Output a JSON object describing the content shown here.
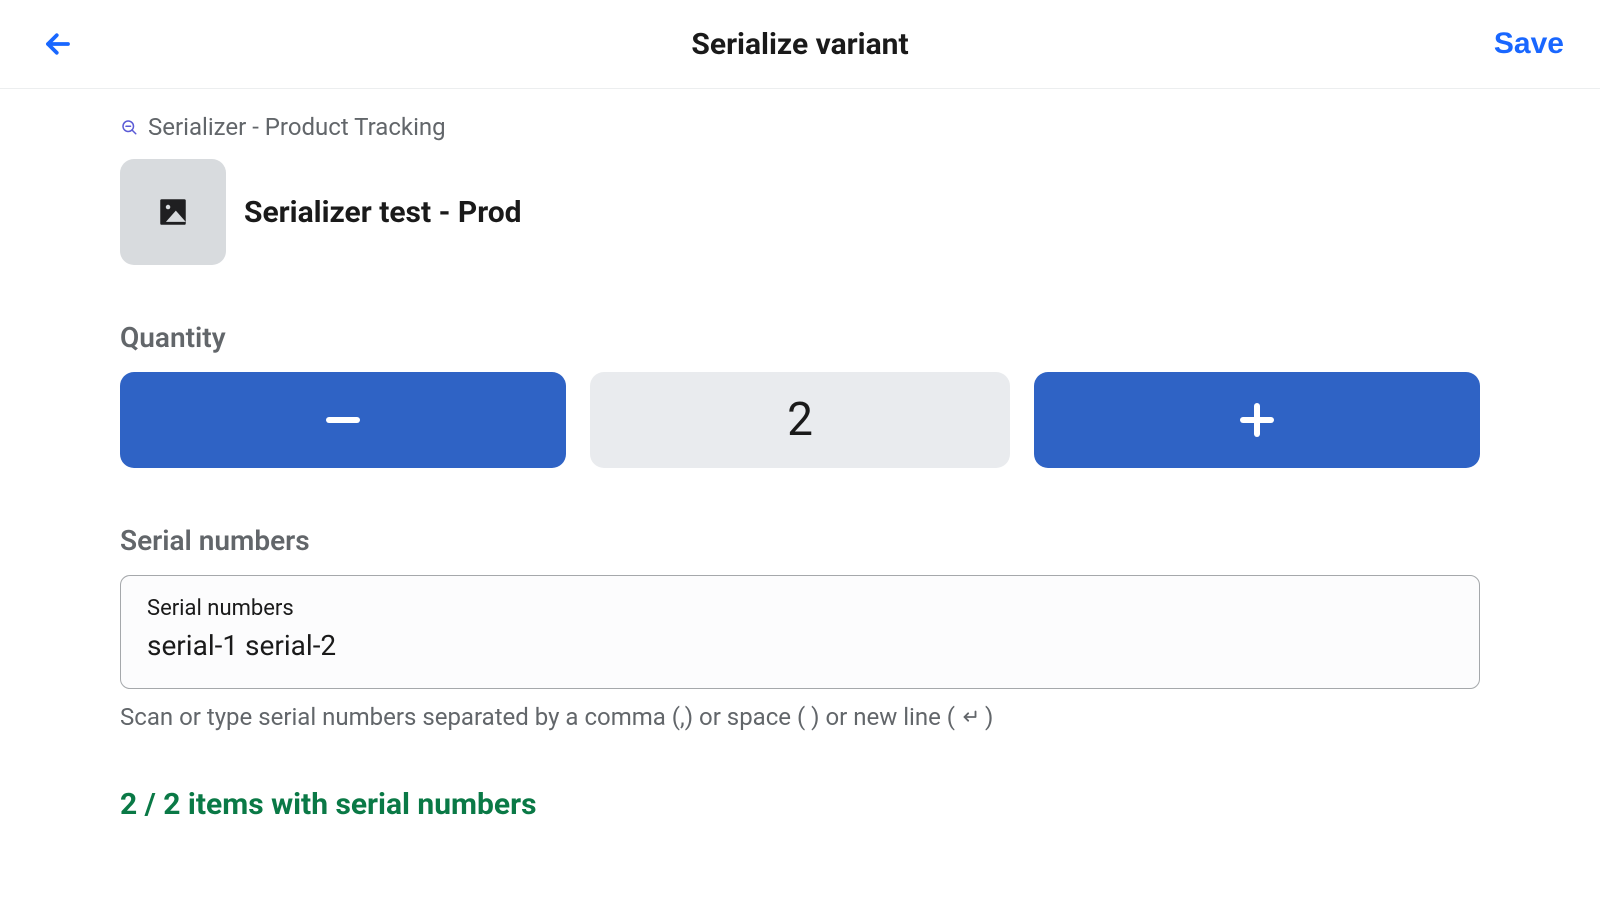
{
  "header": {
    "title": "Serialize variant",
    "save_label": "Save"
  },
  "breadcrumb": {
    "text": "Serializer - Product Tracking"
  },
  "product": {
    "title": "Serializer test - Prod"
  },
  "quantity": {
    "label": "Quantity",
    "value": "2"
  },
  "serials": {
    "label": "Serial numbers",
    "input_label": "Serial numbers",
    "input_value": "serial-1 serial-2",
    "hint_prefix": "Scan or type serial numbers separated by a comma (,) or space ( ) or new line (",
    "hint_suffix": ")"
  },
  "summary": {
    "text": "2 / 2 items with serial numbers"
  }
}
